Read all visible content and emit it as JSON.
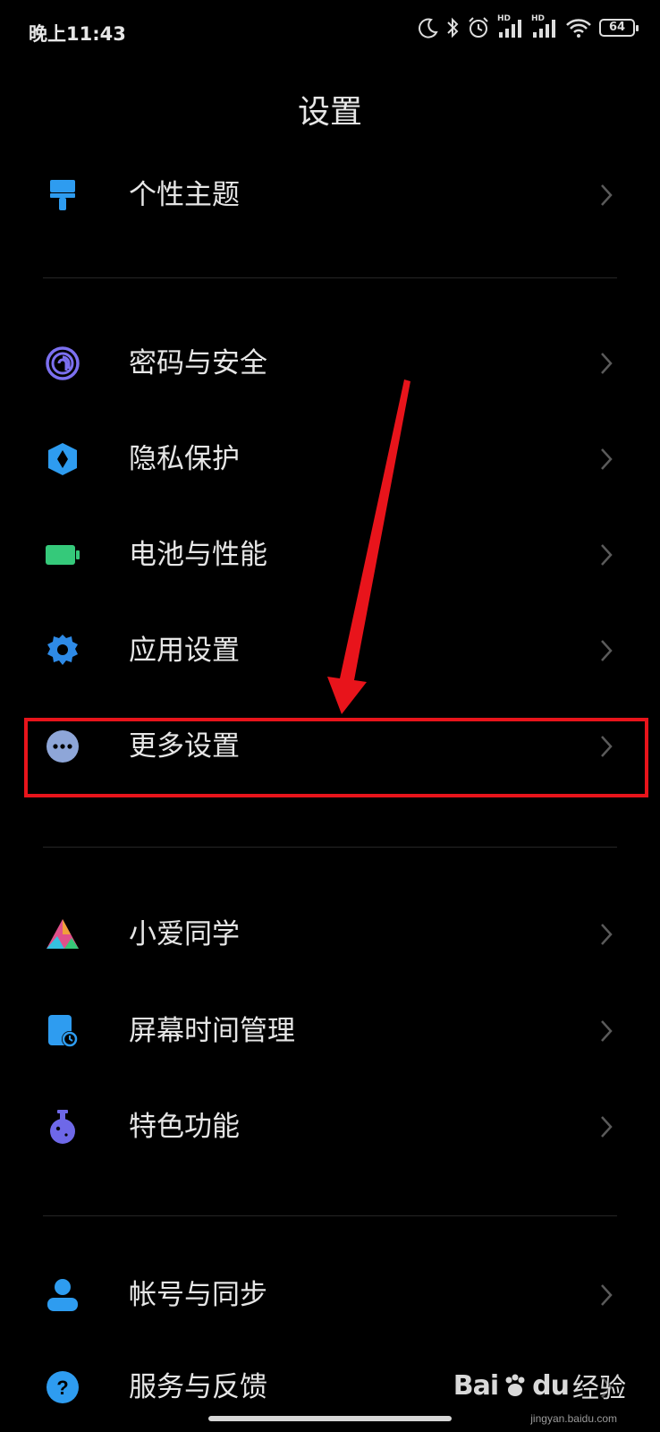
{
  "status_bar": {
    "time": "晚上11:43",
    "signal1_label": "HD",
    "signal2_label": "HD",
    "battery_level": "64"
  },
  "page_title": "设置",
  "items": [
    {
      "label": "个性主题",
      "icon": "theme-brush-icon",
      "color": "#2e9cf0"
    },
    {
      "label": "密码与安全",
      "icon": "fingerprint-icon",
      "color": "#7c70f0"
    },
    {
      "label": "隐私保护",
      "icon": "privacy-shield-icon",
      "color": "#2e9cf0"
    },
    {
      "label": "电池与性能",
      "icon": "battery-icon",
      "color": "#35c97a"
    },
    {
      "label": "应用设置",
      "icon": "gear-icon",
      "color": "#2e8ae6"
    },
    {
      "label": "更多设置",
      "icon": "more-dots-icon",
      "color": "#8ea6d8"
    },
    {
      "label": "小爱同学",
      "icon": "xiaoai-icon",
      "color": "#e0508a"
    },
    {
      "label": "屏幕时间管理",
      "icon": "screen-time-icon",
      "color": "#2e9cf0"
    },
    {
      "label": "特色功能",
      "icon": "flask-icon",
      "color": "#6e68e8"
    },
    {
      "label": "帐号与同步",
      "icon": "account-icon",
      "color": "#2e9cf0"
    },
    {
      "label": "服务与反馈",
      "icon": "help-icon",
      "color": "#2e9cf0"
    }
  ],
  "watermark": {
    "brand": "Bai",
    "brand2": "du",
    "cn": "经验",
    "url": "jingyan.baidu.com"
  },
  "annotation_color": "#e8141b"
}
